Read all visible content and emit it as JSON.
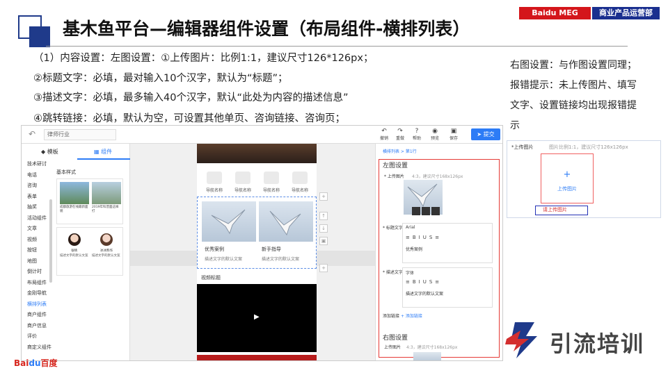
{
  "header": {
    "title": "基木鱼平台—编辑器组件设置（布局组件-横排列表）",
    "badge_left": "Baidu MEG",
    "badge_right": "商业产品运营部"
  },
  "notes_left": [
    "（1）内容设置：左图设置：①上传图片：比例1:1，建议尺寸126*126px；",
    "②标题文字：必填，最对输入10个汉字，默认为“标题”；",
    "③描述文字：必填，最多输入40个汉字，默认“此处为内容的描述信息”",
    "④跳转链接：必填，默认为空，可设置其他单页、咨询链接、咨询页；"
  ],
  "notes_right": [
    "右图设置：与作图设置同理；",
    "报错提示：未上传图片、填写",
    "文字、设置链接均出现报错提",
    "示"
  ],
  "editor": {
    "search_value": "律师行业",
    "toolbar": [
      "撤销",
      "重做",
      "帮助",
      "预览",
      "保存"
    ],
    "submit_label": "提交",
    "tabs": [
      "模板",
      "组件"
    ],
    "categories": [
      "技术研讨",
      "电话",
      "咨询",
      "表单",
      "抽奖",
      "活动组件",
      "文章",
      "视频",
      "按钮",
      "地图",
      "倒计时",
      "布局组件",
      "金刚导航",
      "横排列表",
      "商户组件",
      "商户信息",
      "评价",
      "商定义组件"
    ],
    "active_category": "横排列表",
    "style_heading": "基本样式",
    "card1": {
      "caption_left": "成都旅游在线最新面貌",
      "caption_right": "2019年科普面这样打"
    },
    "card2": {
      "name_left": "张晴",
      "name_right": "冰冰熊作"
    },
    "nav_items": [
      "导航名称",
      "导航名称",
      "导航名称",
      "导航名称"
    ],
    "list_items": [
      {
        "title": "优秀案例",
        "desc": "描述文字的默认文案"
      },
      {
        "title": "新手指导",
        "desc": "描述文字的默认文案"
      }
    ],
    "video_title": "视频标题",
    "side_controls": [
      "+",
      "↑",
      "↓",
      "▣",
      "+"
    ],
    "breadcrumb": "横排列表 > 第1行",
    "left_section": "左图设置",
    "right_section": "右图设置",
    "upload_label": "* 上传图片",
    "upload_hint": "4:3，建议尺寸168x126px",
    "title_label": "* 标题文字",
    "desc_label": "* 描述文字",
    "font_name1": "Arial",
    "font_name2": "字体",
    "title_value": "优秀案例",
    "desc_value": "描述文字的默认文案",
    "add_link_label": "添加链接",
    "add_link_action": "+ 添加链接",
    "right_upload_label": "上传图片",
    "right_upload_hint": "4:3，建议尺寸168x126px"
  },
  "inset": {
    "label": "*上传图片",
    "hint": "图片比例1:1，建议尺寸126x126px",
    "plus": "+",
    "upload": "上传图片",
    "error": "请上传图片"
  },
  "footer": {
    "baidu_left": "Bai",
    "baidu_mid": "du",
    "baidu_right": "百度",
    "brand": "引流培训"
  }
}
